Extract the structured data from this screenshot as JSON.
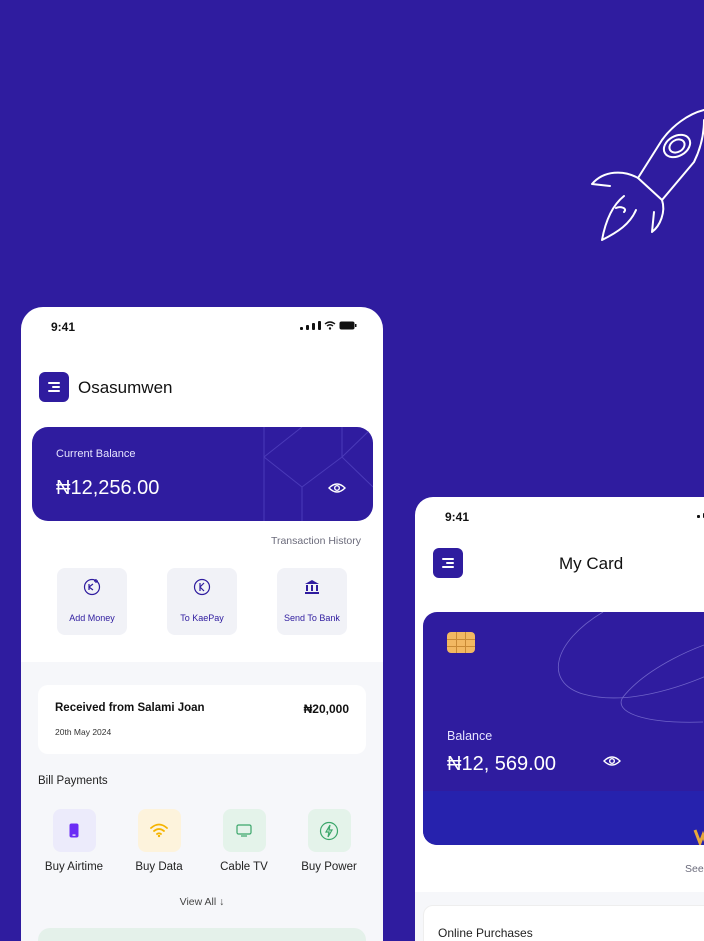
{
  "colors": {
    "brand": "#2f1c9f",
    "background": "#2f1c9f",
    "chip": "#f2b862"
  },
  "left_phone": {
    "status_time": "9:41",
    "username": "Osasumwen",
    "balance": {
      "label": "Current Balance",
      "amount": "₦12,256.00"
    },
    "transaction_history_link": "Transaction History",
    "actions": [
      {
        "label": "Add  Money",
        "icon": "add-money-icon"
      },
      {
        "label": "To KaePay",
        "icon": "kaepay-icon"
      },
      {
        "label": "Send To Bank",
        "icon": "bank-icon"
      }
    ],
    "transaction": {
      "title": "Received from Salami Joan",
      "date": "20th May 2024",
      "amount": "₦20,000"
    },
    "bill_payments": {
      "title": "Bill Payments",
      "items": [
        {
          "label": "Buy Airtime",
          "icon": "phone-icon",
          "tile_color": "#ecebfb"
        },
        {
          "label": "Buy Data",
          "icon": "wifi-icon",
          "tile_color": "#fdf3dc"
        },
        {
          "label": "Cable TV",
          "icon": "tv-icon",
          "tile_color": "#e4f3ea"
        },
        {
          "label": "Buy Power",
          "icon": "power-icon",
          "tile_color": "#e4f3ea"
        }
      ],
      "view_all": "View All ↓"
    }
  },
  "right_phone": {
    "status_time": "9:41",
    "title": "My Card",
    "card": {
      "balance_label": "Balance",
      "balance_amount": "₦12, 569.00"
    },
    "see_link": "See",
    "online_purchases": "Online Purchases"
  }
}
